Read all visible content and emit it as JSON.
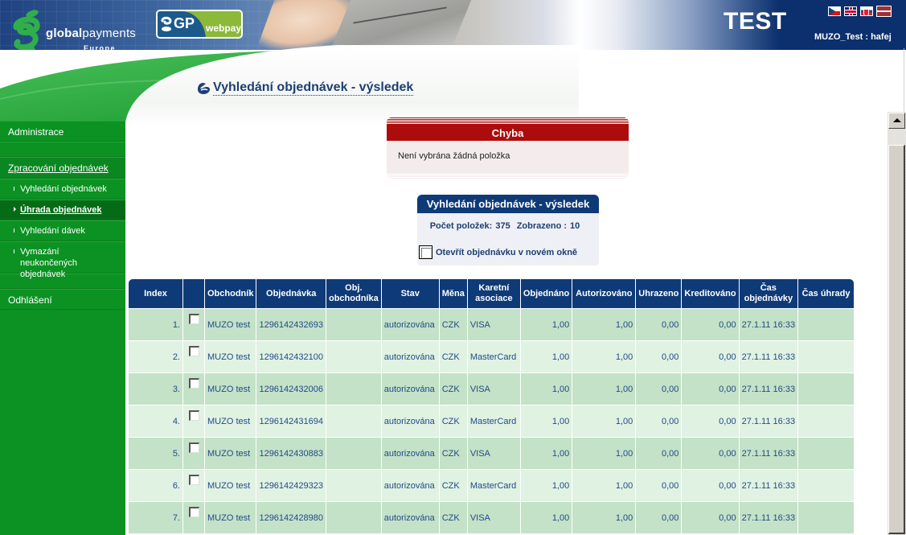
{
  "header": {
    "brand_bold": "global",
    "brand_light": "payments",
    "brand_sub": "Europe",
    "webpay_gp": "GP",
    "webpay_label": "webpay",
    "environment_label": "TEST",
    "user_label": "MUZO_Test : hafej",
    "languages": [
      {
        "code": "cz",
        "icon": "flag-cz-icon"
      },
      {
        "code": "en",
        "icon": "flag-gb-icon"
      },
      {
        "code": "sk",
        "icon": "flag-sk-icon"
      },
      {
        "code": "lv",
        "icon": "flag-lv-icon"
      }
    ]
  },
  "sidebar": {
    "administrace": "Administrace",
    "section_title": "Zpracování objednávek",
    "items": [
      {
        "label": "Vyhledání objednávek",
        "active": false
      },
      {
        "label": "Úhrada objednávek",
        "active": true
      },
      {
        "label": "Vyhledání dávek",
        "active": false
      },
      {
        "label": "Vymazání neukončených objednávek",
        "active": false
      }
    ],
    "logout": "Odhlášení"
  },
  "page": {
    "title": "Vyhledání objednávek - výsledek"
  },
  "error": {
    "title": "Chyba",
    "message": "Není vybrána žádná položka"
  },
  "result": {
    "title": "Vyhledání objednávek - výsledek",
    "count_label": "Počet položek:",
    "count_value": "375",
    "shown_label": "Zobrazeno :",
    "shown_value": "10",
    "new_window_label": "Otevřít objednávku v novém okně",
    "new_window_checked": false
  },
  "table": {
    "headers": [
      "Index",
      "",
      "Obchodník",
      "Objednávka",
      "Obj. obchodníka",
      "Stav",
      "Měna",
      "Karetní asociace",
      "Objednáno",
      "Autorizováno",
      "Uhrazeno",
      "Kreditováno",
      "Čas objednávky",
      "Čas úhrady"
    ],
    "rows": [
      {
        "index": "1.",
        "merchant": "MUZO test",
        "order": "1296142432693",
        "merchant_order": "",
        "status": "autorizována",
        "currency": "CZK",
        "card": "VISA",
        "ordered": "1,00",
        "authorized": "1,00",
        "paid": "0,00",
        "credited": "0,00",
        "order_time": "27.1.11 16:33",
        "paid_time": ""
      },
      {
        "index": "2.",
        "merchant": "MUZO test",
        "order": "1296142432100",
        "merchant_order": "",
        "status": "autorizována",
        "currency": "CZK",
        "card": "MasterCard",
        "ordered": "1,00",
        "authorized": "1,00",
        "paid": "0,00",
        "credited": "0,00",
        "order_time": "27.1.11 16:33",
        "paid_time": ""
      },
      {
        "index": "3.",
        "merchant": "MUZO test",
        "order": "1296142432006",
        "merchant_order": "",
        "status": "autorizována",
        "currency": "CZK",
        "card": "VISA",
        "ordered": "1,00",
        "authorized": "1,00",
        "paid": "0,00",
        "credited": "0,00",
        "order_time": "27.1.11 16:33",
        "paid_time": ""
      },
      {
        "index": "4.",
        "merchant": "MUZO test",
        "order": "1296142431694",
        "merchant_order": "",
        "status": "autorizována",
        "currency": "CZK",
        "card": "MasterCard",
        "ordered": "1,00",
        "authorized": "1,00",
        "paid": "0,00",
        "credited": "0,00",
        "order_time": "27.1.11 16:33",
        "paid_time": ""
      },
      {
        "index": "5.",
        "merchant": "MUZO test",
        "order": "1296142430883",
        "merchant_order": "",
        "status": "autorizována",
        "currency": "CZK",
        "card": "VISA",
        "ordered": "1,00",
        "authorized": "1,00",
        "paid": "0,00",
        "credited": "0,00",
        "order_time": "27.1.11 16:33",
        "paid_time": ""
      },
      {
        "index": "6.",
        "merchant": "MUZO test",
        "order": "1296142429323",
        "merchant_order": "",
        "status": "autorizována",
        "currency": "CZK",
        "card": "MasterCard",
        "ordered": "1,00",
        "authorized": "1,00",
        "paid": "0,00",
        "credited": "0,00",
        "order_time": "27.1.11 16:33",
        "paid_time": ""
      },
      {
        "index": "7.",
        "merchant": "MUZO test",
        "order": "1296142428980",
        "merchant_order": "",
        "status": "autorizována",
        "currency": "CZK",
        "card": "VISA",
        "ordered": "1,00",
        "authorized": "1,00",
        "paid": "0,00",
        "credited": "0,00",
        "order_time": "27.1.11 16:33",
        "paid_time": ""
      }
    ]
  },
  "colors": {
    "brand_navy": "#0e3a78",
    "sidebar_green": "#0b9222",
    "error_red": "#ad0c0c",
    "row_odd": "#c3e2c7",
    "row_even": "#e0f2e2",
    "text_blue": "#244a8a"
  }
}
